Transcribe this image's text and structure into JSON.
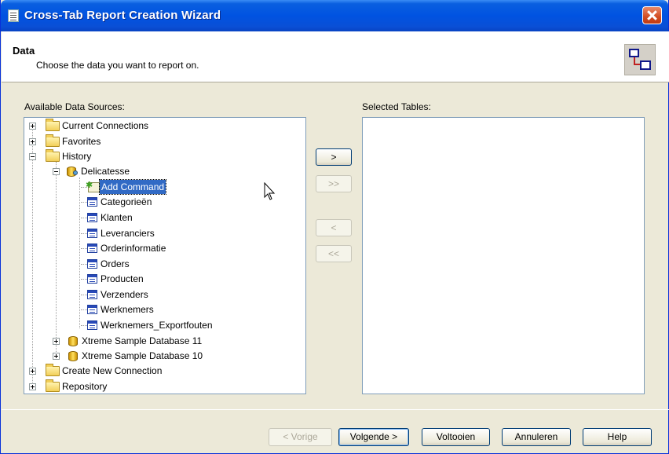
{
  "window": {
    "title": "Cross-Tab Report Creation Wizard"
  },
  "header": {
    "title": "Data",
    "subtitle": "Choose the data you want to report on."
  },
  "left_panel": {
    "label": "Available Data Sources:",
    "tree": [
      {
        "label": "Current Connections",
        "icon": "folder-icon",
        "expander": "plus"
      },
      {
        "label": "Favorites",
        "icon": "folder-icon",
        "expander": "plus"
      },
      {
        "label": "History",
        "icon": "folder-icon",
        "expander": "minus"
      },
      {
        "label": "Delicatesse",
        "icon": "database-icon",
        "expander": "minus"
      },
      {
        "label": "Add Command",
        "icon": "add-command-icon",
        "selected": true
      },
      {
        "label": "Categorieën",
        "icon": "table-icon"
      },
      {
        "label": "Klanten",
        "icon": "table-icon"
      },
      {
        "label": "Leveranciers",
        "icon": "table-icon"
      },
      {
        "label": "Orderinformatie",
        "icon": "table-icon"
      },
      {
        "label": "Orders",
        "icon": "table-icon"
      },
      {
        "label": "Producten",
        "icon": "table-icon"
      },
      {
        "label": "Verzenders",
        "icon": "table-icon"
      },
      {
        "label": "Werknemers",
        "icon": "table-icon"
      },
      {
        "label": "Werknemers_Exportfouten",
        "icon": "table-icon"
      },
      {
        "label": "Xtreme Sample Database 11",
        "icon": "database-icon",
        "expander": "plus"
      },
      {
        "label": "Xtreme Sample Database 10",
        "icon": "database-icon",
        "expander": "plus"
      },
      {
        "label": "Create New Connection",
        "icon": "folder-icon",
        "expander": "plus"
      },
      {
        "label": "Repository",
        "icon": "folder-icon",
        "expander": "plus"
      }
    ]
  },
  "right_panel": {
    "label": "Selected Tables:"
  },
  "move_buttons": {
    "add": ">",
    "add_all": ">>",
    "remove": "<",
    "remove_all": "<<"
  },
  "footer": {
    "back": "< Vorige",
    "next": "Volgende >",
    "finish": "Voltooien",
    "cancel": "Annuleren",
    "help": "Help"
  },
  "colors": {
    "titlebar": "#0053e1",
    "selection": "#316ac5",
    "dialog_bg": "#ece9d8"
  }
}
